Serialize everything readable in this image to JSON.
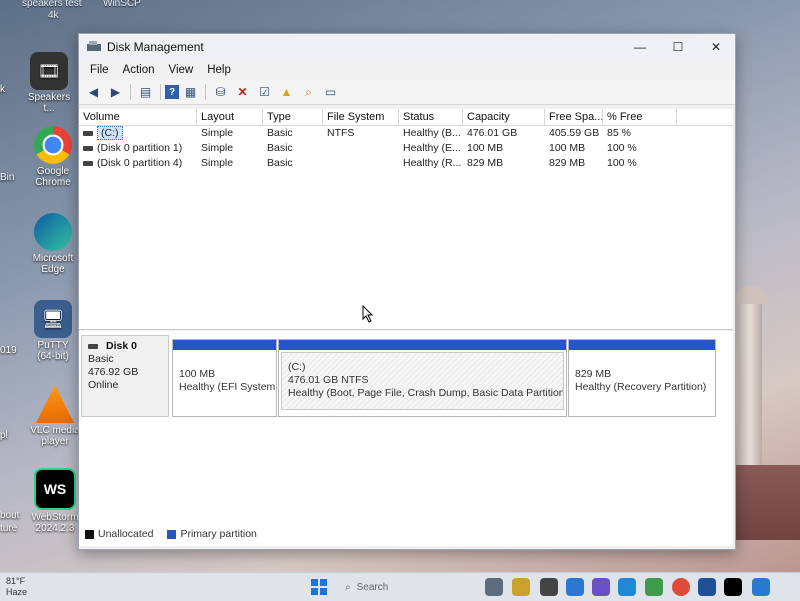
{
  "desktop": {
    "top_labels": [
      "speakers test",
      "4k",
      "WinSCP"
    ],
    "icons": [
      {
        "label": "Speakers t..."
      },
      {
        "label": "Google Chrome"
      },
      {
        "label": "Microsoft Edge"
      },
      {
        "label": "PuTTY (64-bit)"
      },
      {
        "label": "VLC media player"
      },
      {
        "label": "WebStorm 2024.2.3"
      }
    ],
    "edge_labels": [
      "k",
      "Bin",
      "019",
      "pl",
      "bout",
      "ture"
    ]
  },
  "window": {
    "title": "Disk Management",
    "controls": {
      "minimize": "—",
      "maximize": "☐",
      "close": "✕"
    },
    "menu": [
      "File",
      "Action",
      "View",
      "Help"
    ],
    "toolbar_icons": [
      "back-arrow-icon",
      "forward-arrow-icon",
      "properties-icon",
      "help-icon",
      "view-icon",
      "connect-icon",
      "delete-icon",
      "check-icon",
      "folder-up-icon",
      "search-icon",
      "console-icon"
    ]
  },
  "volume_table": {
    "columns": [
      "Volume",
      "Layout",
      "Type",
      "File System",
      "Status",
      "Capacity",
      "Free Spa...",
      "% Free"
    ],
    "rows": [
      {
        "volume": "(C:)",
        "layout": "Simple",
        "type": "Basic",
        "fs": "NTFS",
        "status": "Healthy (B...",
        "capacity": "476.01 GB",
        "free": "405.59 GB",
        "pct": "85 %"
      },
      {
        "volume": "(Disk 0 partition 1)",
        "layout": "Simple",
        "type": "Basic",
        "fs": "",
        "status": "Healthy (E...",
        "capacity": "100 MB",
        "free": "100 MB",
        "pct": "100 %"
      },
      {
        "volume": "(Disk 0 partition 4)",
        "layout": "Simple",
        "type": "Basic",
        "fs": "",
        "status": "Healthy (R...",
        "capacity": "829 MB",
        "free": "829 MB",
        "pct": "100 %"
      }
    ]
  },
  "disk": {
    "name": "Disk 0",
    "type": "Basic",
    "size": "476.92 GB",
    "state": "Online",
    "partitions": [
      {
        "title": "",
        "size": "100 MB",
        "status": "Healthy (EFI System"
      },
      {
        "title": "(C:)",
        "size": "476.01 GB NTFS",
        "status": "Healthy (Boot, Page File, Crash Dump, Basic Data Partition)"
      },
      {
        "title": "",
        "size": "829 MB",
        "status": "Healthy (Recovery Partition)"
      }
    ]
  },
  "legend": {
    "unallocated": "Unallocated",
    "primary": "Primary partition",
    "unallocated_color": "#111111",
    "primary_color": "#2456c9"
  },
  "taskbar": {
    "weather": "81°F",
    "weather_sub": "Haze",
    "search": "Search"
  }
}
